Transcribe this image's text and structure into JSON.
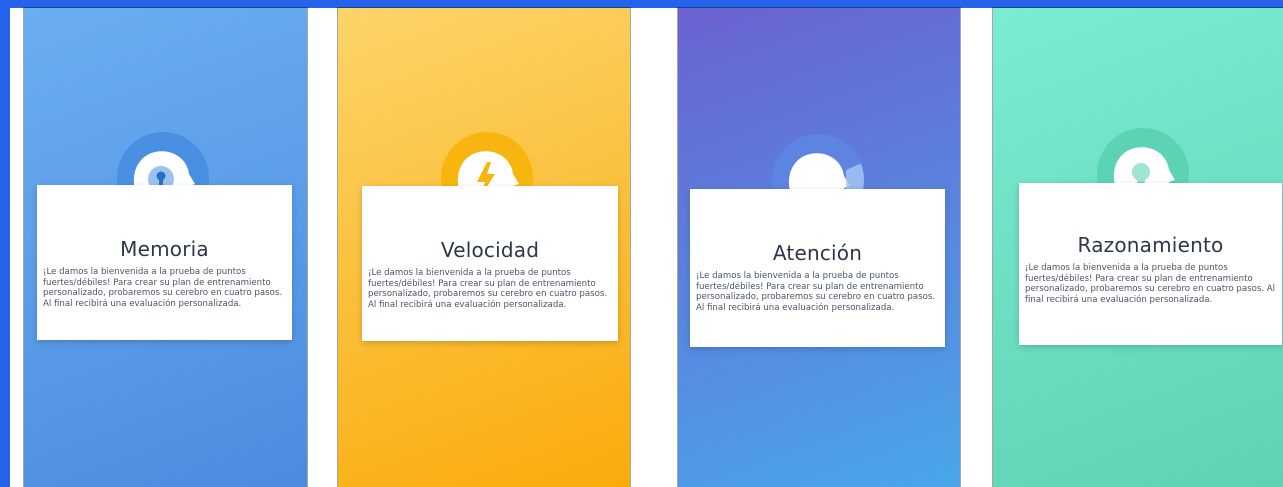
{
  "screens": [
    {
      "title": "Memoria",
      "body": "¡Le damos la bienvenida a la prueba de puntos fuertes/débiles! Para crear su plan de entrenamiento personalizado, probaremos su cerebro en cuatro pasos. Al final recibirá una evaluación personalizada.",
      "icon": "head-keyhole-icon",
      "gradient": [
        "#6aaef0",
        "#4b8be0"
      ],
      "accent": "#4a90e2"
    },
    {
      "title": "Velocidad",
      "body": "¡Le damos la bienvenida a la prueba de puntos fuertes/débiles! Para crear su plan de entrenamiento personalizado, probaremos su cerebro en cuatro pasos. Al final recibirá una evaluación personalizada.",
      "icon": "head-lightning-icon",
      "gradient": [
        "#fcd46a",
        "#f9ab0a"
      ],
      "accent": "#f9b50f"
    },
    {
      "title": "Atención",
      "body": "¡Le damos la bienvenida a la prueba de puntos fuertes/débiles! Para crear su plan de entrenamiento personalizado, probaremos su cerebro en cuatro pasos. Al final recibirá una evaluación personalizada.",
      "icon": "head-focus-icon",
      "gradient": [
        "#6a62d2",
        "#49a6ea"
      ],
      "accent": "#5d84e0"
    },
    {
      "title": "Razonamiento",
      "body": "¡Le damos la bienvenida a la prueba de puntos fuertes/débiles! Para crear su plan de entrenamiento personalizado, probaremos su cerebro en cuatro pasos. Al final recibirá una evaluación personalizada.",
      "icon": "head-lightbulb-icon",
      "gradient": [
        "#7aecd2",
        "#5fd1b4"
      ],
      "accent": "#5dd3b5"
    }
  ]
}
